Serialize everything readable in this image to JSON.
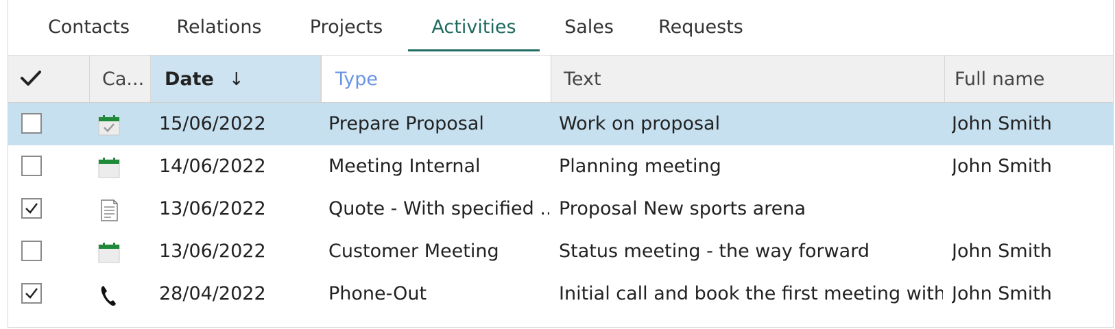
{
  "tabs": [
    {
      "label": "Contacts",
      "active": false
    },
    {
      "label": "Relations",
      "active": false
    },
    {
      "label": "Projects",
      "active": false
    },
    {
      "label": "Activities",
      "active": true
    },
    {
      "label": "Sales",
      "active": false
    },
    {
      "label": "Requests",
      "active": false
    }
  ],
  "columns": {
    "select_icon": "checkmark-icon",
    "category": "Ca...",
    "date": "Date",
    "date_sort_icon": "↓",
    "type": "Type",
    "text": "Text",
    "full_name": "Full name"
  },
  "rows": [
    {
      "checked": false,
      "selected": true,
      "icon": "calendar-done-icon",
      "date": "15/06/2022",
      "type": "Prepare Proposal",
      "text": "Work on proposal",
      "full_name": "John Smith"
    },
    {
      "checked": false,
      "selected": false,
      "icon": "calendar-icon",
      "date": "14/06/2022",
      "type": "Meeting Internal",
      "text": "Planning meeting",
      "full_name": "John Smith"
    },
    {
      "checked": true,
      "selected": false,
      "icon": "document-icon",
      "date": "13/06/2022",
      "type": "Quote - With specified ...",
      "text": "Proposal New sports arena",
      "full_name": ""
    },
    {
      "checked": false,
      "selected": false,
      "icon": "calendar-icon",
      "date": "13/06/2022",
      "type": "Customer Meeting",
      "text": "Status meeting - the way forward",
      "full_name": "John Smith"
    },
    {
      "checked": true,
      "selected": false,
      "icon": "phone-icon",
      "date": "28/04/2022",
      "type": "Phone-Out",
      "text": "Initial call and book the first meeting with ...",
      "full_name": "John Smith"
    }
  ],
  "colors": {
    "accent": "#1f6b5f",
    "selected_row": "#c6e0f0",
    "sorted_header": "#cde3f1",
    "calendar_green": "#1e8a3a",
    "filter_text": "#6a93e6"
  }
}
